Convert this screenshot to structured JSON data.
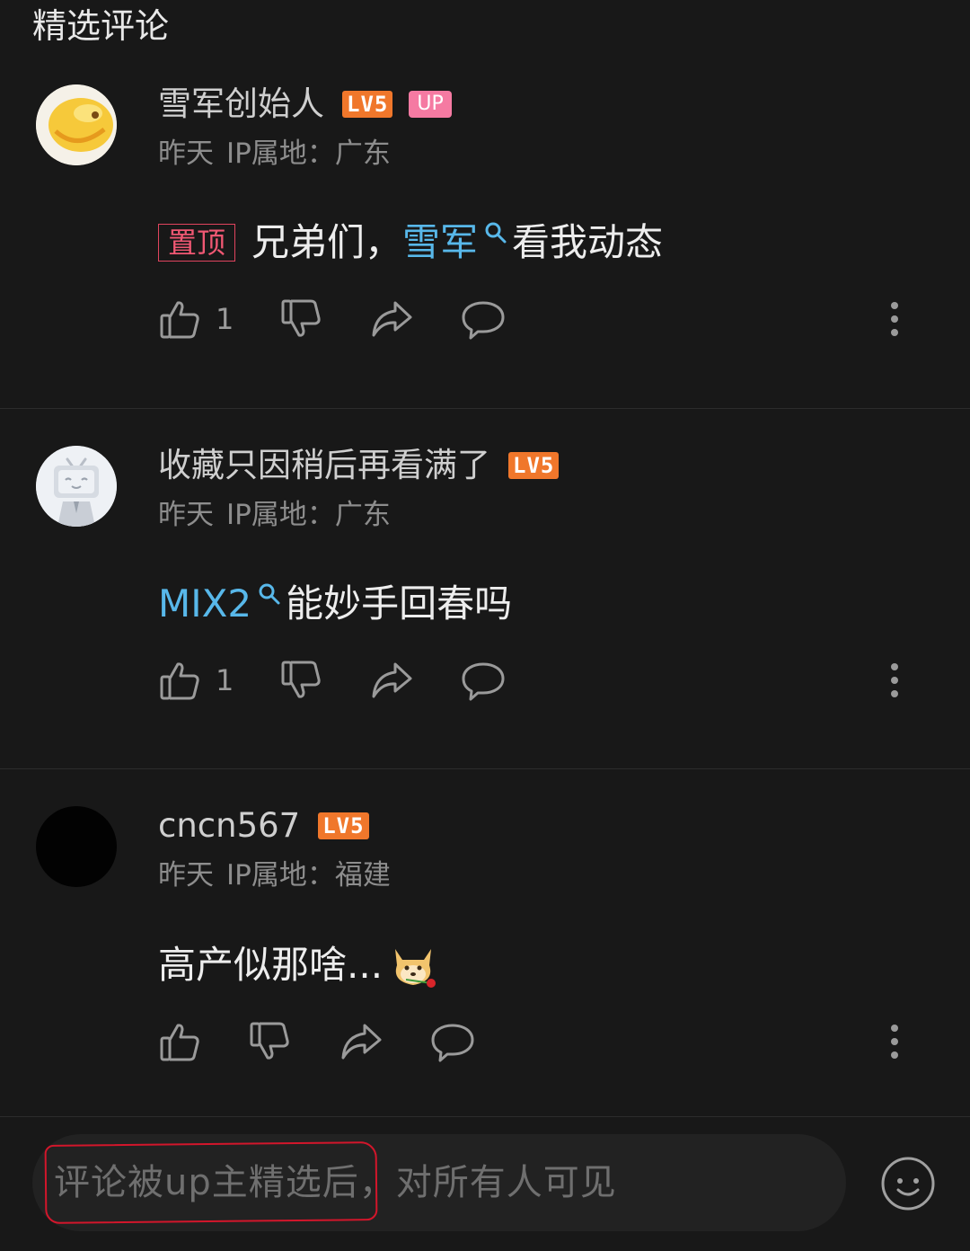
{
  "section": {
    "title": "精选评论"
  },
  "comments": [
    {
      "username": "雪军创始人",
      "level": "LV5",
      "up_badge": "UP",
      "time": "昨天",
      "ip": "IP属地：广东",
      "pin_tag": "置顶",
      "content_before": "兄弟们，",
      "link_text": "雪军",
      "content_after": "看我动态",
      "likes": "1"
    },
    {
      "username": "收藏只因稍后再看满了",
      "level": "LV5",
      "time": "昨天",
      "ip": "IP属地：广东",
      "link_text": "MIX2",
      "content_after": "能妙手回春吗",
      "likes": "1"
    },
    {
      "username": "cncn567",
      "level": "LV5",
      "time": "昨天",
      "ip": "IP属地：福建",
      "content": "高产似那啥..."
    }
  ],
  "input": {
    "placeholder": "评论被up主精选后，对所有人可见"
  },
  "colors": {
    "background": "#181818",
    "level_badge": "#f0772b",
    "up_badge": "#f57aa2",
    "link": "#58b8ea",
    "pin": "#e0445e",
    "annotation": "#d3162b"
  },
  "icons": [
    "like-icon",
    "dislike-icon",
    "share-icon",
    "reply-icon",
    "more-icon",
    "search-icon",
    "doge-emoji",
    "emoji-icon"
  ]
}
